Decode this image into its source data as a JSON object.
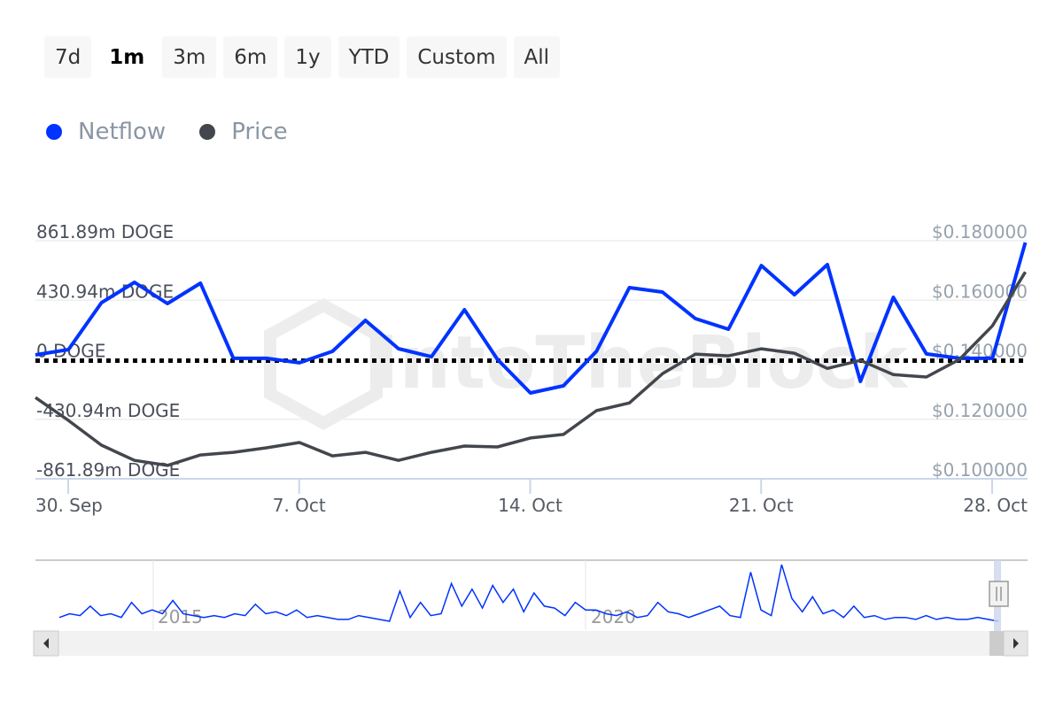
{
  "range_selector": {
    "buttons": [
      "7d",
      "1m",
      "3m",
      "6m",
      "1y",
      "YTD",
      "Custom",
      "All"
    ],
    "selected": "1m"
  },
  "legend": [
    {
      "name": "Netflow",
      "color": "#0033ff"
    },
    {
      "name": "Price",
      "color": "#43474d"
    }
  ],
  "watermark": "IntoTheBlock",
  "chart_data": {
    "type": "line",
    "x": [
      "29 Sep",
      "30 Sep",
      "1 Oct",
      "2 Oct",
      "3 Oct",
      "4 Oct",
      "5 Oct",
      "6 Oct",
      "7 Oct",
      "8 Oct",
      "9 Oct",
      "10 Oct",
      "11 Oct",
      "12 Oct",
      "13 Oct",
      "14 Oct",
      "15 Oct",
      "16 Oct",
      "17 Oct",
      "18 Oct",
      "19 Oct",
      "20 Oct",
      "21 Oct",
      "22 Oct",
      "23 Oct",
      "24 Oct",
      "25 Oct",
      "26 Oct",
      "27 Oct",
      "28 Oct",
      "29 Oct"
    ],
    "x_ticks": [
      "30. Sep",
      "7. Oct",
      "14. Oct",
      "21. Oct",
      "28. Oct"
    ],
    "series": [
      {
        "name": "Netflow",
        "axis": "left",
        "unit": "m DOGE",
        "color": "#0033ff",
        "values": [
          35,
          74,
          413,
          561,
          407,
          554,
          10,
          10,
          -22,
          61,
          285,
          80,
          22,
          362,
          3,
          -240,
          -189,
          61,
          522,
          490,
          298,
          221,
          682,
          471,
          689,
          -157,
          452,
          42,
          10,
          10,
          849
        ]
      },
      {
        "name": "Price",
        "axis": "right",
        "unit": "USD",
        "color": "#43474d",
        "values": [
          0.1273,
          0.1196,
          0.1113,
          0.1062,
          0.1045,
          0.108,
          0.1089,
          0.1104,
          0.1122,
          0.1077,
          0.1089,
          0.1062,
          0.1089,
          0.111,
          0.1107,
          0.1137,
          0.1149,
          0.1229,
          0.1255,
          0.1353,
          0.1419,
          0.1413,
          0.1437,
          0.1422,
          0.1371,
          0.1398,
          0.135,
          0.1342,
          0.1401,
          0.1514,
          0.1695
        ]
      }
    ],
    "left_axis": {
      "ticks": [
        "861.89m DOGE",
        "430.94m DOGE",
        "0 DOGE",
        "-430.94m DOGE",
        "-861.89m DOGE"
      ],
      "range": [
        -861.89,
        861.89
      ]
    },
    "right_axis": {
      "ticks": [
        "$0.180000",
        "$0.160000",
        "$0.140000",
        "$0.120000",
        "$0.100000"
      ],
      "range": [
        0.1,
        0.18
      ]
    },
    "zero_line": "dotted",
    "grid": true,
    "legend_position": "top-left",
    "navigator": {
      "labels": [
        "2015",
        "2020"
      ],
      "values": [
        2,
        4,
        3,
        8,
        3,
        4,
        2,
        10,
        4,
        6,
        4,
        11,
        4,
        3,
        2,
        3,
        2,
        4,
        3,
        9,
        4,
        5,
        3,
        6,
        2,
        3,
        2,
        1,
        1,
        3,
        2,
        1,
        0,
        16,
        2,
        10,
        3,
        4,
        20,
        8,
        17,
        7,
        19,
        10,
        17,
        5,
        15,
        8,
        7,
        3,
        10,
        6,
        6,
        4,
        3,
        5,
        2,
        3,
        10,
        5,
        4,
        2,
        4,
        6,
        8,
        3,
        2,
        26,
        6,
        3,
        30,
        12,
        5,
        13,
        4,
        6,
        2,
        8,
        2,
        3,
        1,
        2,
        2,
        1,
        3,
        1,
        2,
        1,
        1,
        2,
        1,
        0
      ]
    }
  }
}
